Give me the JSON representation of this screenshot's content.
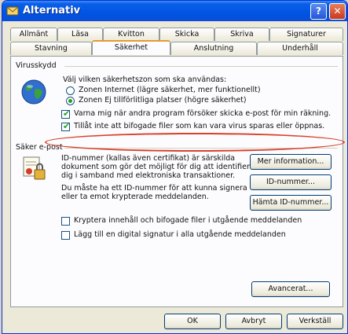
{
  "window": {
    "title": "Alternativ"
  },
  "tabs_row1": [
    "Allmänt",
    "Läsa",
    "Kvitton",
    "Skicka",
    "Skriva",
    "Signaturer"
  ],
  "tabs_row2": [
    "Stavning",
    "Säkerhet",
    "Anslutning",
    "Underhåll"
  ],
  "active_tab": "Säkerhet",
  "virus": {
    "heading": "Virusskydd",
    "zone_prompt": "Välj vilken säkerhetszon som ska användas:",
    "zone_internet": "Zonen Internet (lägre säkerhet, mer funktionellt)",
    "zone_restricted": "Zonen Ej tillförlitliga platser (högre säkerhet)",
    "selected_zone": "restricted",
    "warn_label": "Varna mig när andra program försöker skicka e-post för min räkning.",
    "warn_checked": true,
    "block_label": "Tillåt inte att bifogade filer som kan vara virus sparas eller öppnas.",
    "block_checked": true
  },
  "secure": {
    "heading": "Säker e-post",
    "desc1": [
      "ID-nummer (kallas även certifikat) är särskilda",
      "dokument som gör det möjligt för dig att identifiera",
      "dig i samband med elektroniska transaktioner."
    ],
    "desc2": [
      "Du måste ha ett ID-nummer för att kunna signera",
      "eller ta emot krypterade meddelanden."
    ],
    "btn_more": "Mer information...",
    "btn_id": "ID-nummer...",
    "btn_fetch": "Hämta ID-nummer...",
    "encrypt_label": "Kryptera innehåll och bifogade filer i utgående meddelanden",
    "encrypt_checked": false,
    "sign_label": "Lägg till en digital signatur i alla utgående meddelanden",
    "sign_checked": false
  },
  "buttons": {
    "advanced": "Avancerat...",
    "ok": "OK",
    "cancel": "Avbryt",
    "apply": "Verkställ"
  }
}
